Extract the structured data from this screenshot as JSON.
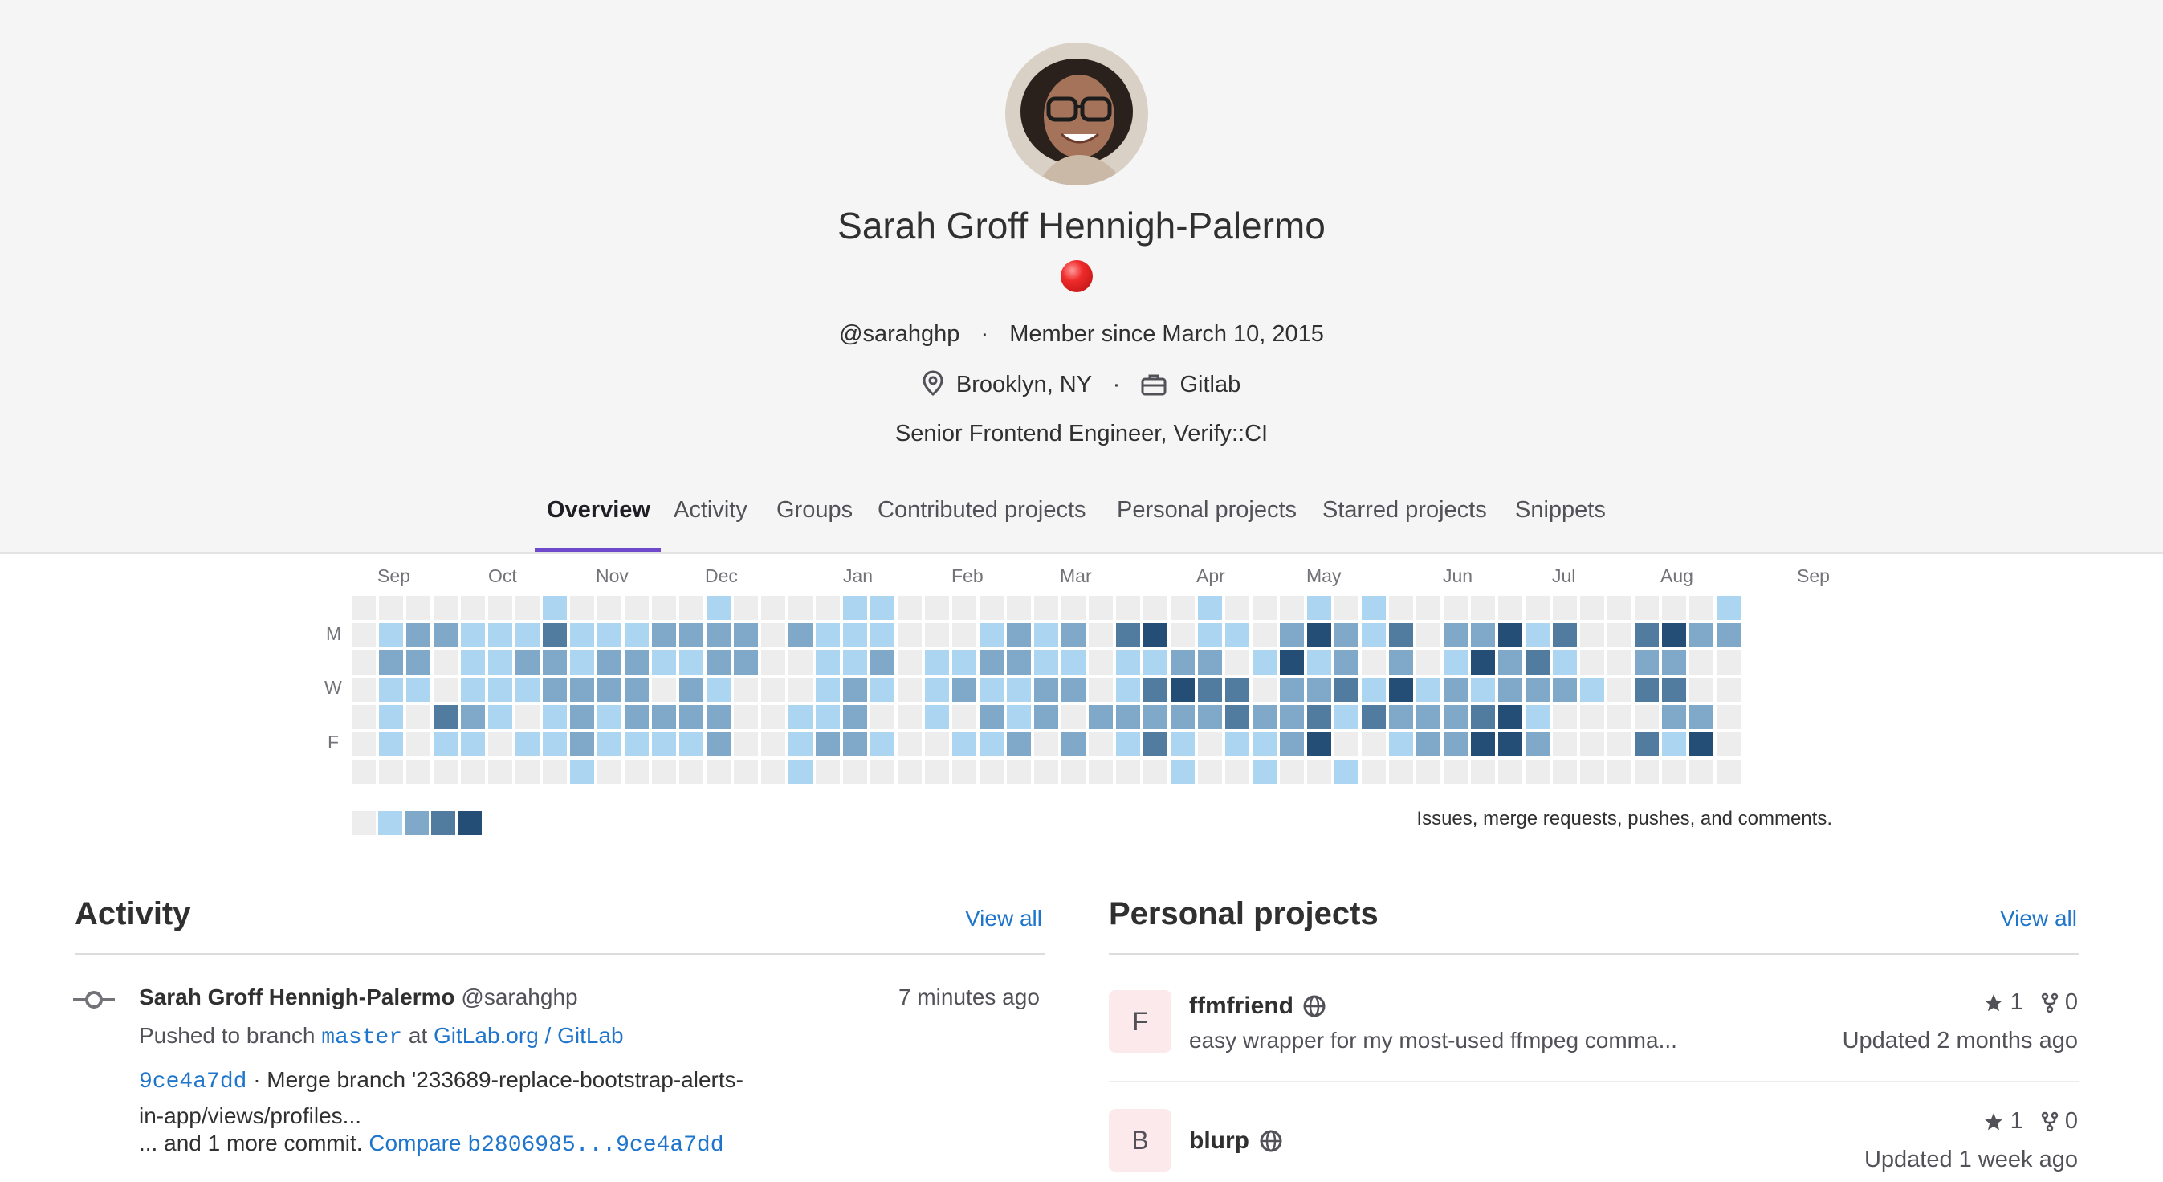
{
  "profile": {
    "name": "Sarah Groff Hennigh-Palermo",
    "status_emoji": "red-circle",
    "username": "@sarahghp",
    "member_since": "Member since March 10, 2015",
    "location": "Brooklyn, NY",
    "organization": "Gitlab",
    "job_title": "Senior Frontend Engineer, Verify::CI"
  },
  "tabs": [
    {
      "label": "Overview",
      "active": true
    },
    {
      "label": "Activity"
    },
    {
      "label": "Groups"
    },
    {
      "label": "Contributed projects"
    },
    {
      "label": "Personal projects"
    },
    {
      "label": "Starred projects"
    },
    {
      "label": "Snippets"
    }
  ],
  "calendar": {
    "months": [
      "Sep",
      "Oct",
      "Nov",
      "Dec",
      "Jan",
      "Feb",
      "Mar",
      "Apr",
      "May",
      "Jun",
      "Jul",
      "Aug",
      "Sep"
    ],
    "days": [
      "M",
      "W",
      "F"
    ],
    "legend_text": "Issues, merge requests, pushes, and comments.",
    "level_colors": [
      "#ededed",
      "#acd5f2",
      "#7fa8c9",
      "#527ba0",
      "#254e77"
    ],
    "weeks": [
      [
        0,
        0,
        0,
        0,
        0,
        0,
        0
      ],
      [
        0,
        1,
        2,
        1,
        1,
        1,
        0
      ],
      [
        0,
        2,
        2,
        1,
        0,
        0,
        0
      ],
      [
        0,
        2,
        0,
        0,
        3,
        1,
        0
      ],
      [
        0,
        1,
        1,
        1,
        2,
        1,
        0
      ],
      [
        0,
        1,
        1,
        1,
        1,
        0,
        0
      ],
      [
        0,
        1,
        2,
        1,
        0,
        1,
        0
      ],
      [
        1,
        3,
        2,
        2,
        1,
        1,
        0
      ],
      [
        0,
        1,
        1,
        2,
        2,
        2,
        1
      ],
      [
        0,
        1,
        2,
        2,
        1,
        1,
        0
      ],
      [
        0,
        1,
        2,
        2,
        2,
        1,
        0
      ],
      [
        0,
        2,
        1,
        0,
        2,
        1,
        0
      ],
      [
        0,
        2,
        1,
        2,
        2,
        1,
        0
      ],
      [
        1,
        2,
        2,
        1,
        2,
        2,
        0
      ],
      [
        0,
        2,
        2,
        0,
        0,
        0,
        0
      ],
      [
        0,
        0,
        0,
        0,
        0,
        0,
        0
      ],
      [
        0,
        2,
        0,
        0,
        1,
        1,
        1
      ],
      [
        0,
        1,
        1,
        1,
        1,
        2,
        0
      ],
      [
        1,
        1,
        1,
        2,
        2,
        2,
        0
      ],
      [
        1,
        1,
        2,
        1,
        0,
        1,
        0
      ],
      [
        0,
        0,
        0,
        0,
        0,
        0,
        0
      ],
      [
        0,
        0,
        1,
        1,
        1,
        0,
        0
      ],
      [
        0,
        0,
        1,
        2,
        0,
        1,
        0
      ],
      [
        0,
        1,
        2,
        1,
        2,
        1,
        0
      ],
      [
        0,
        2,
        2,
        1,
        1,
        2,
        0
      ],
      [
        0,
        1,
        1,
        2,
        2,
        0,
        0
      ],
      [
        0,
        2,
        1,
        2,
        0,
        2,
        0
      ],
      [
        0,
        0,
        0,
        0,
        2,
        0,
        0
      ],
      [
        0,
        3,
        1,
        1,
        2,
        1,
        0
      ],
      [
        0,
        4,
        1,
        3,
        2,
        3,
        0
      ],
      [
        0,
        0,
        2,
        4,
        2,
        1,
        1
      ],
      [
        1,
        1,
        2,
        3,
        2,
        0,
        0
      ],
      [
        0,
        1,
        0,
        3,
        3,
        1,
        0
      ],
      [
        0,
        0,
        1,
        0,
        2,
        1,
        1
      ],
      [
        0,
        2,
        4,
        2,
        2,
        2,
        0
      ],
      [
        1,
        4,
        1,
        2,
        3,
        4,
        0
      ],
      [
        0,
        2,
        2,
        3,
        1,
        0,
        1
      ],
      [
        1,
        1,
        0,
        1,
        3,
        0,
        0
      ],
      [
        0,
        3,
        2,
        4,
        2,
        1,
        0
      ],
      [
        0,
        0,
        0,
        1,
        2,
        2,
        0
      ],
      [
        0,
        2,
        1,
        2,
        2,
        2,
        0
      ],
      [
        0,
        2,
        4,
        1,
        3,
        4,
        0
      ],
      [
        0,
        4,
        2,
        2,
        4,
        4,
        0
      ],
      [
        0,
        1,
        3,
        2,
        1,
        2,
        0
      ],
      [
        0,
        3,
        1,
        2,
        0,
        0,
        0
      ],
      [
        0,
        0,
        0,
        1,
        0,
        0,
        0
      ],
      [
        0,
        0,
        0,
        0,
        0,
        0,
        0
      ],
      [
        0,
        3,
        2,
        3,
        0,
        3,
        0
      ],
      [
        0,
        4,
        2,
        3,
        2,
        1,
        0
      ],
      [
        0,
        2,
        0,
        0,
        2,
        4,
        0
      ],
      [
        1,
        2,
        0,
        0,
        0,
        0,
        0
      ]
    ]
  },
  "activity": {
    "title": "Activity",
    "view_all": "View all",
    "event": {
      "author_name": "Sarah Groff Hennigh-Palermo",
      "author_handle": "@sarahghp",
      "time": "7 minutes ago",
      "action": "Pushed to branch",
      "branch": "master",
      "at": "at",
      "project": "GitLab.org / GitLab",
      "commit_sha": "9ce4a7dd",
      "commit_message": "· Merge branch '233689-replace-bootstrap-alerts-in-app/views/profiles...",
      "more_commits": "... and 1 more commit.",
      "compare_label": "Compare",
      "compare_range": "b2806985...9ce4a7dd"
    }
  },
  "personal_projects": {
    "title": "Personal projects",
    "view_all": "View all",
    "items": [
      {
        "initial": "F",
        "name": "ffmfriend",
        "description": "easy wrapper for my most-used ffmpeg comma...",
        "stars": "1",
        "forks": "0",
        "updated": "Updated 2 months ago"
      },
      {
        "initial": "B",
        "name": "blurp",
        "description": "",
        "stars": "1",
        "forks": "0",
        "updated": "Updated 1 week ago"
      }
    ]
  }
}
